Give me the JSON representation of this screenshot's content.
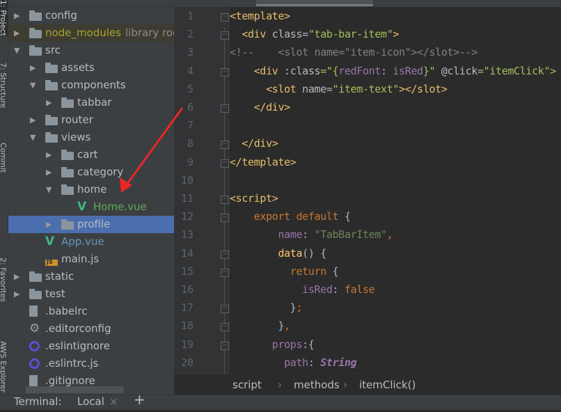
{
  "left_strip": [
    "1: Project",
    "7: Structure",
    "Commit",
    "2: Favorites",
    "AWS Explorer"
  ],
  "tree": [
    {
      "label": "config",
      "type": "folder",
      "depth": 0,
      "arrow": "right"
    },
    {
      "label": "node_modules",
      "extra": "library root",
      "type": "folder",
      "depth": 0,
      "arrow": "right",
      "style": "lib"
    },
    {
      "label": "src",
      "type": "folder",
      "depth": 0,
      "arrow": "down"
    },
    {
      "label": "assets",
      "type": "folder",
      "depth": 1,
      "arrow": "right"
    },
    {
      "label": "components",
      "type": "folder",
      "depth": 1,
      "arrow": "down"
    },
    {
      "label": "tabbar",
      "type": "folder",
      "depth": 2,
      "arrow": "right"
    },
    {
      "label": "router",
      "type": "folder",
      "depth": 1,
      "arrow": "right"
    },
    {
      "label": "views",
      "type": "folder",
      "depth": 1,
      "arrow": "down"
    },
    {
      "label": "cart",
      "type": "folder",
      "depth": 2,
      "arrow": "right"
    },
    {
      "label": "category",
      "type": "folder",
      "depth": 2,
      "arrow": "right"
    },
    {
      "label": "home",
      "type": "folder",
      "depth": 2,
      "arrow": "down"
    },
    {
      "label": "Home.vue",
      "type": "vue",
      "depth": 3,
      "color": "#62a857"
    },
    {
      "label": "profile",
      "type": "folder",
      "depth": 2,
      "arrow": "right",
      "style": "sel"
    },
    {
      "label": "App.vue",
      "type": "vue",
      "depth": 1,
      "color": "#6897bb"
    },
    {
      "label": "main.js",
      "type": "js",
      "depth": 1
    },
    {
      "label": "static",
      "type": "folder",
      "depth": 0,
      "arrow": "right"
    },
    {
      "label": "test",
      "type": "folder",
      "depth": 0,
      "arrow": "right"
    },
    {
      "label": ".babelrc",
      "type": "file",
      "depth": 0
    },
    {
      "label": ".editorconfig",
      "type": "gear",
      "depth": 0
    },
    {
      "label": ".eslintignore",
      "type": "eslint",
      "depth": 0
    },
    {
      "label": ".eslintrc.js",
      "type": "eslint",
      "depth": 0
    },
    {
      "label": ".gitignore",
      "type": "file",
      "depth": 0
    }
  ],
  "js_badge": "JS",
  "code": [
    {
      "n": "1",
      "fold": "open",
      "tokens": [
        [
          "<template>",
          "tag"
        ]
      ]
    },
    {
      "n": "2",
      "fold": "open",
      "tokens": [
        [
          "  <div ",
          "tag"
        ],
        [
          "class",
          "attr"
        ],
        [
          "=",
          "def"
        ],
        [
          "\"tab-bar-item\"",
          "str"
        ],
        [
          ">",
          "tag"
        ]
      ]
    },
    {
      "n": "3",
      "tokens": [
        [
          "<!--    <slot name=\"item-icon\"></slot>-->",
          "cmt"
        ]
      ]
    },
    {
      "n": "4",
      "fold": "open",
      "tokens": [
        [
          "    <div ",
          "tag"
        ],
        [
          ":class",
          "attr"
        ],
        [
          "=\"{",
          "str"
        ],
        [
          "redFont",
          "pur"
        ],
        [
          ": ",
          "def"
        ],
        [
          "isRed",
          "pur"
        ],
        [
          "}\" ",
          "str"
        ],
        [
          "@click",
          "attr"
        ],
        [
          "=\"itemClick\">",
          "str"
        ]
      ]
    },
    {
      "n": "5",
      "tokens": [
        [
          "      <slot ",
          "tag"
        ],
        [
          "name",
          "attr"
        ],
        [
          "=",
          "def"
        ],
        [
          "\"item-text\"",
          "str"
        ],
        [
          "></slot>",
          "tag"
        ]
      ]
    },
    {
      "n": "6",
      "fold": "close",
      "tokens": [
        [
          "    </div>",
          "tag"
        ]
      ]
    },
    {
      "n": "7",
      "tokens": []
    },
    {
      "n": "8",
      "fold": "close",
      "tokens": [
        [
          "  </div>",
          "tag"
        ]
      ]
    },
    {
      "n": "9",
      "fold": "close",
      "tokens": [
        [
          "</template>",
          "tag"
        ]
      ]
    },
    {
      "n": "10",
      "tokens": []
    },
    {
      "n": "11",
      "fold": "open",
      "tokens": [
        [
          "<script>",
          "tag"
        ]
      ]
    },
    {
      "n": "12",
      "fold": "open",
      "tokens": [
        [
          "    export default ",
          "kw"
        ],
        [
          "{",
          "def"
        ]
      ]
    },
    {
      "n": "13",
      "tokens": [
        [
          "        name",
          "pur"
        ],
        [
          ": ",
          "def"
        ],
        [
          "\"TabBarItem\"",
          "jstr"
        ],
        [
          ",",
          "kw"
        ]
      ]
    },
    {
      "n": "14",
      "fold": "open",
      "tokens": [
        [
          "        data",
          "fn"
        ],
        [
          "() {",
          "def"
        ]
      ]
    },
    {
      "n": "15",
      "fold": "open",
      "tokens": [
        [
          "          return ",
          "kw"
        ],
        [
          "{",
          "def"
        ]
      ]
    },
    {
      "n": "16",
      "tokens": [
        [
          "            isRed",
          "pur"
        ],
        [
          ": ",
          "def"
        ],
        [
          "false",
          "kw"
        ]
      ]
    },
    {
      "n": "17",
      "fold": "close",
      "tokens": [
        [
          "          }",
          "def"
        ],
        [
          ";",
          "kw"
        ]
      ]
    },
    {
      "n": "18",
      "fold": "close",
      "tokens": [
        [
          "        }",
          "def"
        ],
        [
          ",",
          "kw"
        ]
      ]
    },
    {
      "n": "19",
      "fold": "open",
      "tokens": [
        [
          "       props",
          "pur"
        ],
        [
          ":{",
          "def"
        ]
      ]
    },
    {
      "n": "20",
      "tokens": [
        [
          "         path",
          "pur"
        ],
        [
          ": ",
          "def"
        ],
        [
          "String",
          "it"
        ]
      ]
    }
  ],
  "breadcrumb": [
    "script",
    "methods",
    "itemClick()"
  ],
  "breadcrumb_sep": "›",
  "terminal": {
    "label": "Terminal:",
    "tab": "Local",
    "close": "×",
    "add": "+"
  },
  "annotation_arrow_color": "#e8262a"
}
